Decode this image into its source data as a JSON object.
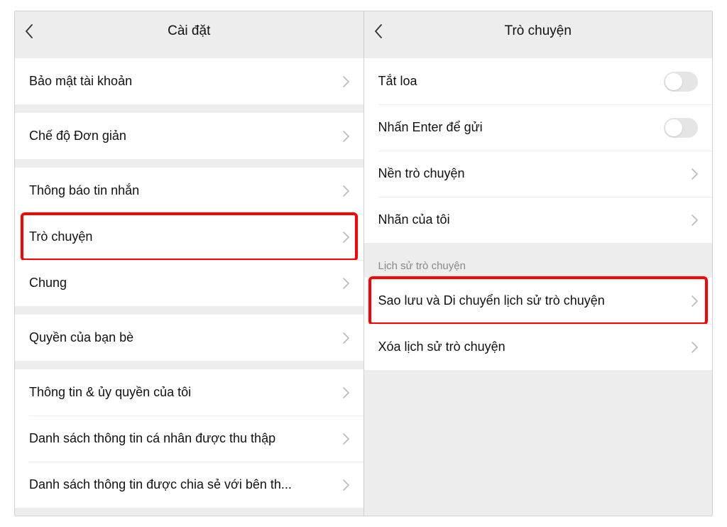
{
  "left": {
    "title": "Cài đặt",
    "rows": {
      "account_security": "Bảo mật tài khoản",
      "simple_mode": "Chế độ Đơn giản",
      "message_notifications": "Thông báo tin nhắn",
      "chat": "Trò chuyện",
      "general": "Chung",
      "friend_permissions": "Quyền của bạn bè",
      "my_info_auth": "Thông tin & ủy quyền của tôi",
      "personal_info_collected": "Danh sách thông tin cá nhân được thu thập",
      "info_shared_third_party": "Danh sách thông tin được chia sẻ với bên th..."
    }
  },
  "right": {
    "title": "Trò chuyện",
    "rows": {
      "speaker_off": "Tắt loa",
      "enter_to_send": "Nhấn Enter để gửi",
      "chat_background": "Nền trò chuyện",
      "my_stickers": "Nhãn của tôi",
      "backup_migrate_history": "Sao lưu và Di chuyển lịch sử trò chuyện",
      "delete_history": "Xóa lịch sử trò chuyện"
    },
    "section_history": "Lịch sử trò chuyện"
  }
}
